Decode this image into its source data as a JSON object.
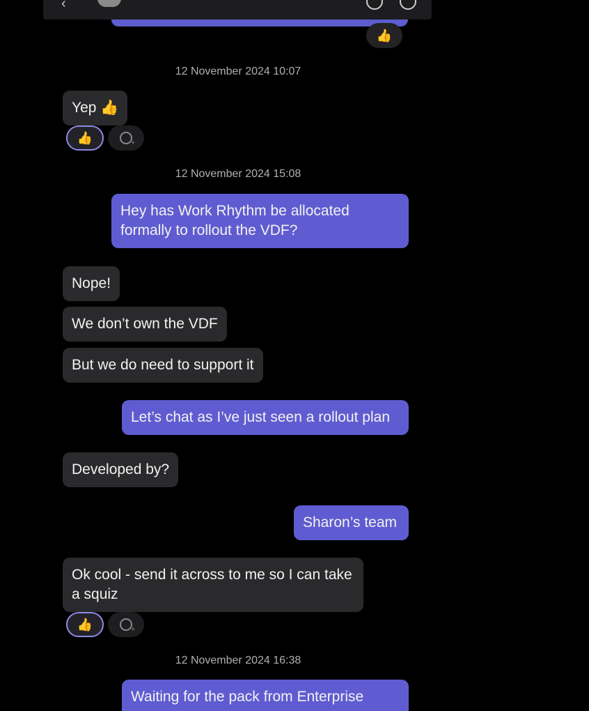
{
  "header": {
    "back_icon": "back-arrow-icon",
    "avatar_icon": "avatar",
    "action_icons": [
      "call-icon",
      "info-icon"
    ]
  },
  "reactions": {
    "thumbs_up": "👍"
  },
  "timestamps": [
    "12 November 2024 10:07",
    "12 November 2024 15:08",
    "12 November 2024 16:38"
  ],
  "messages": [
    {
      "direction": "in",
      "text": "Yep 👍"
    },
    {
      "direction": "out",
      "text": "Hey has Work Rhythm be allocated formally to rollout the VDF?"
    },
    {
      "direction": "in",
      "text": "Nope!"
    },
    {
      "direction": "in",
      "text": "We don’t own the VDF"
    },
    {
      "direction": "in",
      "text": "But we do need to support it"
    },
    {
      "direction": "out",
      "text": "Let’s chat as I’ve just seen a rollout plan"
    },
    {
      "direction": "in",
      "text": "Developed by?"
    },
    {
      "direction": "out",
      "text": "Sharon’s team"
    },
    {
      "direction": "in",
      "text": "Ok cool - send it across to me so I can take a squiz"
    },
    {
      "direction": "out",
      "text": "Waiting for the pack from Enterprise"
    }
  ],
  "colors": {
    "background": "#000000",
    "incoming_bubble": "#2a2a2c",
    "outgoing_bubble": "#5f5cd1",
    "reaction_border": "#8d8ae6",
    "timestamp_text": "#b0b0b0"
  }
}
